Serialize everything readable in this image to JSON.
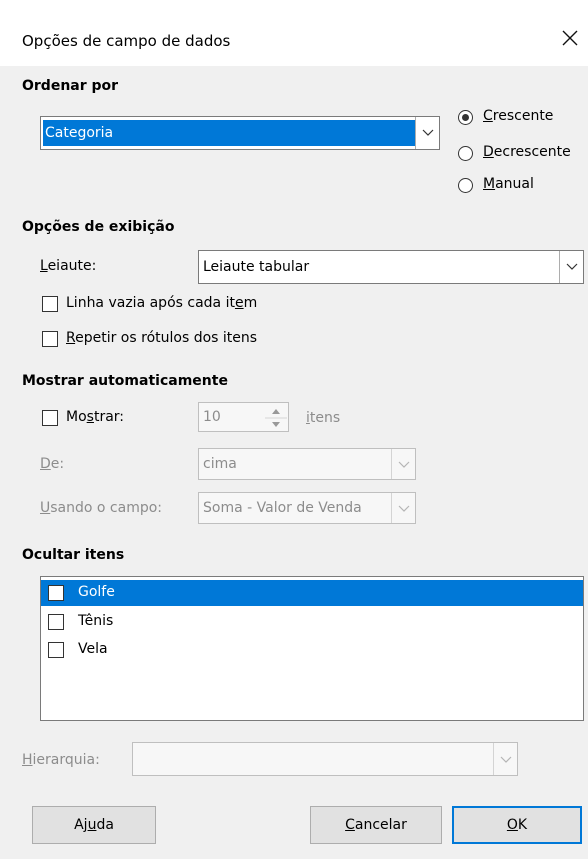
{
  "dialog": {
    "title": "Opções de campo de dados"
  },
  "sort": {
    "heading": "Ordenar por",
    "field_value": "Categoria",
    "radio_ascending": "Crescente",
    "radio_descending": "Decrescente",
    "radio_manual": "Manual",
    "selected": "Crescente"
  },
  "display": {
    "heading": "Opções de exibição",
    "layout_label": "Leiaute:",
    "layout_value": "Leiaute tabular",
    "empty_line_label": "Linha vazia após cada item",
    "repeat_labels_label": "Repetir os rótulos dos itens"
  },
  "auto_show": {
    "heading": "Mostrar automaticamente",
    "show_label": "Mostrar:",
    "count_value": "10",
    "items_label": "itens",
    "from_label": "De:",
    "from_value": "cima",
    "using_field_label": "Usando o campo:",
    "using_field_value": "Soma - Valor de Venda"
  },
  "hide_items": {
    "heading": "Ocultar itens",
    "items": [
      {
        "label": "Golfe",
        "selected": true
      },
      {
        "label": "Tênis",
        "selected": false
      },
      {
        "label": "Vela",
        "selected": false
      }
    ]
  },
  "hierarchy": {
    "label": "Hierarquia:",
    "value": ""
  },
  "buttons": {
    "help": "Ajuda",
    "cancel": "Cancelar",
    "ok": "OK"
  },
  "colors": {
    "accent": "#0078d7",
    "disabled_text": "#8c8c8c",
    "background": "#f0f0f0"
  }
}
